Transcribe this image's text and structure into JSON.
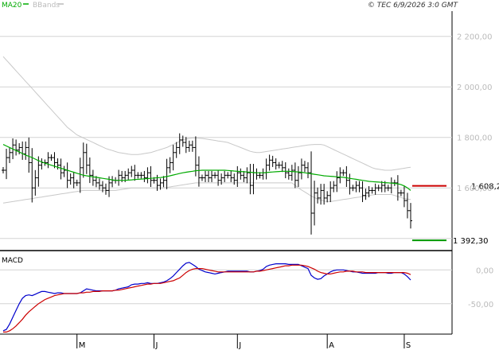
{
  "header": {
    "legend": [
      {
        "label": "MA20",
        "color": "#00aa00"
      },
      {
        "label": "BBands",
        "color": "#bbbbbb"
      }
    ],
    "copyright": "© TEC 6/9/2026 3:0 GMT"
  },
  "chart_data": [
    {
      "type": "line",
      "panel": "price",
      "yticks": [
        {
          "value": 1600,
          "label": "1 600,00"
        },
        {
          "value": 1800,
          "label": "1 800,00"
        },
        {
          "value": 2000,
          "label": "2 000,00"
        },
        {
          "value": 2200,
          "label": "2 200,00"
        }
      ],
      "ylim": [
        1355,
        2300
      ],
      "x_tick_labels": [
        "M",
        "J",
        "J",
        "A",
        "S"
      ],
      "x_tick_index": [
        23,
        47,
        73,
        101,
        125
      ],
      "n_bars": 128,
      "close": [
        1670,
        1720,
        1740,
        1770,
        1750,
        1760,
        1735,
        1760,
        1700,
        1600,
        1640,
        1690,
        1700,
        1700,
        1720,
        1720,
        1700,
        1690,
        1660,
        1670,
        1630,
        1640,
        1620,
        1620,
        1680,
        1740,
        1690,
        1650,
        1630,
        1620,
        1610,
        1600,
        1590,
        1620,
        1630,
        1630,
        1650,
        1640,
        1650,
        1660,
        1670,
        1650,
        1650,
        1650,
        1640,
        1660,
        1630,
        1630,
        1610,
        1620,
        1630,
        1680,
        1700,
        1740,
        1760,
        1790,
        1780,
        1760,
        1770,
        1760,
        1690,
        1640,
        1640,
        1650,
        1640,
        1650,
        1650,
        1630,
        1640,
        1650,
        1650,
        1640,
        1630,
        1660,
        1650,
        1640,
        1660,
        1610,
        1660,
        1650,
        1650,
        1660,
        1690,
        1710,
        1700,
        1690,
        1690,
        1680,
        1660,
        1650,
        1670,
        1630,
        1660,
        1690,
        1680,
        1660,
        1500,
        1580,
        1560,
        1590,
        1560,
        1570,
        1600,
        1610,
        1640,
        1660,
        1660,
        1630,
        1600,
        1600,
        1610,
        1600,
        1570,
        1580,
        1590,
        1590,
        1600,
        1600,
        1610,
        1600,
        1600,
        1620,
        1620,
        1580,
        1580,
        1550,
        1510,
        1470
      ],
      "series": [
        {
          "values": [
            1772,
            1766,
            1760,
            1754,
            1748,
            1742,
            1736,
            1730,
            1725,
            1720,
            1714,
            1708,
            1703,
            1698,
            1694,
            1690,
            1686,
            1682,
            1678,
            1674,
            1670,
            1666,
            1662,
            1658,
            1654,
            1650,
            1648,
            1646,
            1644,
            1642,
            1640,
            1638,
            1636,
            1634,
            1632,
            1630,
            1630,
            1630,
            1630,
            1631,
            1632,
            1633,
            1634,
            1635,
            1636,
            1637,
            1638,
            1639,
            1640,
            1641,
            1643,
            1645,
            1648,
            1651,
            1654,
            1657,
            1660,
            1662,
            1664,
            1666,
            1668,
            1669,
            1670,
            1670,
            1670,
            1670,
            1670,
            1670,
            1670,
            1670,
            1669,
            1668,
            1667,
            1666,
            1665,
            1664,
            1663,
            1662,
            1661,
            1660,
            1660,
            1660,
            1661,
            1662,
            1663,
            1664,
            1665,
            1666,
            1666,
            1666,
            1665,
            1664,
            1663,
            1662,
            1660,
            1658,
            1656,
            1654,
            1652,
            1650,
            1648,
            1647,
            1646,
            1645,
            1644,
            1643,
            1642,
            1640,
            1638,
            1636,
            1634,
            1632,
            1630,
            1628,
            1626,
            1625,
            1624,
            1623,
            1622,
            1621,
            1620,
            1619,
            1618,
            1616,
            1613,
            1608,
            1600,
            1590
          ]
        },
        {
          "values": [
            2120,
            2106,
            2092,
            2078,
            2064,
            2050,
            2036,
            2022,
            2008,
            1994,
            1980,
            1966,
            1952,
            1938,
            1924,
            1910,
            1896,
            1882,
            1868,
            1854,
            1840,
            1830,
            1820,
            1810,
            1804,
            1798,
            1792,
            1786,
            1780,
            1774,
            1768,
            1762,
            1756,
            1752,
            1748,
            1744,
            1740,
            1738,
            1736,
            1734,
            1732,
            1732,
            1732,
            1734,
            1736,
            1738,
            1740,
            1744,
            1748,
            1752,
            1756,
            1760,
            1766,
            1772,
            1778,
            1784,
            1790,
            1794,
            1796,
            1798,
            1798,
            1797,
            1796,
            1794,
            1792,
            1790,
            1788,
            1786,
            1784,
            1782,
            1780,
            1775,
            1770,
            1765,
            1760,
            1755,
            1750,
            1745,
            1742,
            1740,
            1740,
            1742,
            1744,
            1746,
            1748,
            1750,
            1752,
            1754,
            1756,
            1758,
            1760,
            1762,
            1764,
            1766,
            1768,
            1770,
            1771,
            1772,
            1772,
            1772,
            1770,
            1764,
            1758,
            1752,
            1746,
            1740,
            1734,
            1728,
            1722,
            1716,
            1710,
            1704,
            1698,
            1692,
            1686,
            1680,
            1676,
            1674,
            1672,
            1670,
            1670,
            1670,
            1672,
            1674,
            1676,
            1678,
            1680,
            1682
          ]
        },
        {
          "values": [
            1540,
            1542,
            1544,
            1546,
            1548,
            1550,
            1552,
            1554,
            1556,
            1558,
            1560,
            1562,
            1564,
            1566,
            1568,
            1570,
            1572,
            1574,
            1576,
            1578,
            1580,
            1582,
            1584,
            1586,
            1588,
            1590,
            1590,
            1590,
            1590,
            1590,
            1590,
            1590,
            1590,
            1590,
            1590,
            1590,
            1592,
            1594,
            1596,
            1598,
            1600,
            1600,
            1600,
            1600,
            1600,
            1600,
            1600,
            1600,
            1600,
            1600,
            1600,
            1602,
            1604,
            1606,
            1608,
            1610,
            1612,
            1614,
            1616,
            1618,
            1620,
            1620,
            1620,
            1620,
            1620,
            1620,
            1620,
            1620,
            1620,
            1620,
            1620,
            1620,
            1620,
            1620,
            1620,
            1620,
            1620,
            1620,
            1620,
            1620,
            1620,
            1620,
            1620,
            1620,
            1620,
            1620,
            1620,
            1620,
            1620,
            1620,
            1620,
            1610,
            1600,
            1592,
            1584,
            1576,
            1568,
            1562,
            1556,
            1552,
            1548,
            1546,
            1546,
            1548,
            1550,
            1552,
            1554,
            1556,
            1558,
            1560,
            1562,
            1564,
            1566,
            1568,
            1570,
            1572,
            1574,
            1574,
            1574,
            1574,
            1574,
            1574,
            1570,
            1566,
            1562,
            1558,
            1556,
            1554
          ]
        }
      ],
      "levels": [
        {
          "value": 1608.2,
          "label": "1 608,2",
          "color": "#cc0000"
        },
        {
          "value": 1392.3,
          "label": "1 392,30",
          "color": "#009900"
        }
      ]
    },
    {
      "type": "line",
      "panel": "macd",
      "title": "MACD",
      "yticks": [
        {
          "value": 0,
          "label": "0,00"
        },
        {
          "value": -50,
          "label": "-50,00"
        }
      ],
      "ylim": [
        -95,
        25
      ],
      "n_bars": 128,
      "series": [
        {
          "color": "#0000cc",
          "values": [
            -90,
            -88,
            -80,
            -70,
            -60,
            -50,
            -42,
            -38,
            -37,
            -38,
            -36,
            -34,
            -32,
            -32,
            -33,
            -34,
            -35,
            -34,
            -34,
            -35,
            -35,
            -35,
            -35,
            -35,
            -34,
            -31,
            -28,
            -29,
            -30,
            -31,
            -31,
            -31,
            -31,
            -31,
            -31,
            -30,
            -28,
            -27,
            -26,
            -25,
            -22,
            -21,
            -21,
            -20,
            -20,
            -19,
            -20,
            -20,
            -20,
            -19,
            -18,
            -16,
            -13,
            -9,
            -4,
            1,
            6,
            10,
            11,
            8,
            5,
            1,
            -1,
            -3,
            -4,
            -5,
            -6,
            -5,
            -4,
            -3,
            -2,
            -2,
            -2,
            -2,
            -2,
            -2,
            -2,
            -3,
            -3,
            -2,
            -1,
            1,
            5,
            7,
            8,
            9,
            9,
            9,
            9,
            8,
            8,
            8,
            8,
            6,
            4,
            2,
            -8,
            -12,
            -14,
            -13,
            -9,
            -6,
            -3,
            -1,
            0,
            0,
            0,
            -1,
            -2,
            -3,
            -3,
            -4,
            -5,
            -5,
            -5,
            -5,
            -5,
            -4,
            -4,
            -4,
            -5,
            -5,
            -4,
            -4,
            -4,
            -6,
            -10,
            -15
          ]
        },
        {
          "color": "#cc0000",
          "values": [
            -92,
            -92,
            -90,
            -87,
            -83,
            -78,
            -73,
            -67,
            -62,
            -58,
            -54,
            -50,
            -47,
            -44,
            -42,
            -40,
            -38,
            -37,
            -36,
            -35,
            -35,
            -35,
            -35,
            -35,
            -34,
            -34,
            -33,
            -33,
            -32,
            -32,
            -32,
            -31,
            -31,
            -31,
            -31,
            -30,
            -30,
            -29,
            -28,
            -27,
            -26,
            -25,
            -24,
            -23,
            -22,
            -21,
            -21,
            -20,
            -20,
            -20,
            -19,
            -18,
            -17,
            -16,
            -14,
            -12,
            -8,
            -4,
            -1,
            1,
            2,
            2,
            2,
            1,
            0,
            -1,
            -2,
            -3,
            -3,
            -3,
            -3,
            -3,
            -3,
            -3,
            -3,
            -3,
            -3,
            -3,
            -3,
            -2,
            -2,
            -1,
            0,
            1,
            2,
            3,
            4,
            5,
            6,
            6,
            7,
            7,
            7,
            7,
            6,
            5,
            3,
            1,
            -2,
            -4,
            -5,
            -6,
            -6,
            -5,
            -4,
            -3,
            -3,
            -2,
            -2,
            -2,
            -3,
            -3,
            -3,
            -4,
            -4,
            -4,
            -4,
            -4,
            -4,
            -4,
            -4,
            -4,
            -4,
            -4,
            -4,
            -4,
            -5,
            -7
          ]
        }
      ]
    }
  ]
}
